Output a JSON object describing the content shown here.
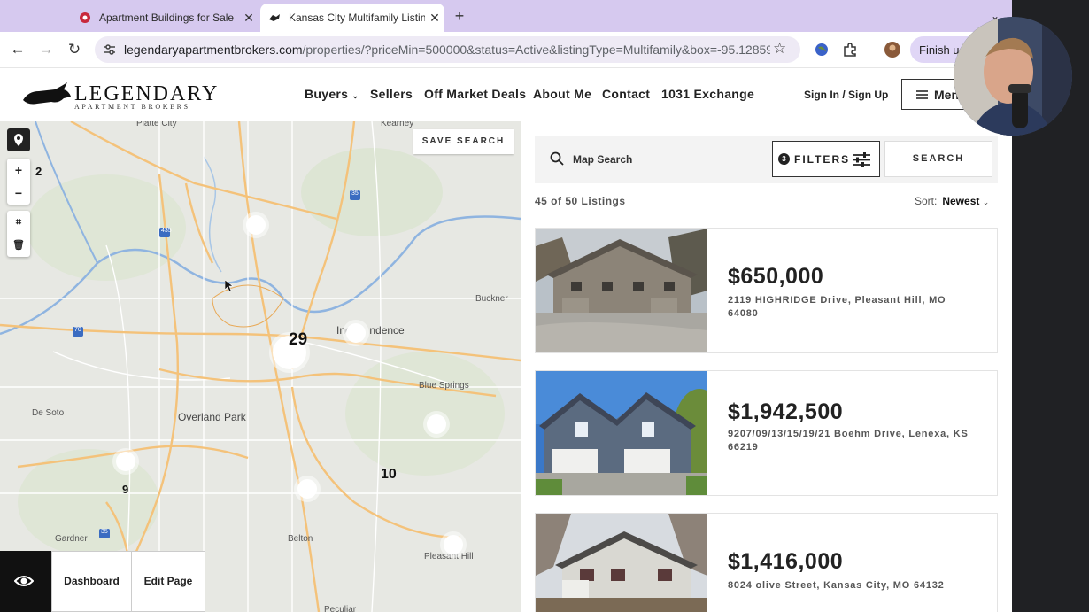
{
  "browser": {
    "tabs": [
      {
        "title": "Apartment Buildings for Sale",
        "active": false
      },
      {
        "title": "Kansas City Multifamily Listin",
        "active": true
      }
    ],
    "url_domain": "legendaryapartmentbrokers.com",
    "url_path": "/properties/?priceMin=500000&status=Active&listingType=Multifamily&box=-95.12859...",
    "finish_label": "Finish u"
  },
  "site": {
    "logo_word": "LEGENDARY",
    "logo_sub": "APARTMENT BROKERS",
    "nav": [
      "Buyers",
      "Sellers",
      "Off Market Deals",
      "About Me",
      "Contact",
      "1031 Exchange"
    ],
    "sign_in": "Sign In",
    "sign_sep": "/",
    "sign_up": "Sign Up",
    "menu_label": "Menu"
  },
  "map": {
    "save_search": "SAVE SEARCH",
    "zoom_level": "2",
    "labels": {
      "platte_city": "Platte City",
      "kearney": "Kearney",
      "buckner": "Buckner",
      "independence": "Inde",
      "independence2": "ndence",
      "blue_springs": "Blue Springs",
      "overland_park": "Overland Park",
      "de_soto": "De Soto",
      "gardner": "Gardner",
      "belton": "Belton",
      "pleasant_hill": "Pleasant Hill",
      "peculiar": "Peculiar"
    },
    "road_numbers": [
      "435",
      "35",
      "70",
      "35"
    ],
    "cluster_counts": [
      "29",
      "10",
      "9"
    ]
  },
  "admin": {
    "dashboard": "Dashboard",
    "edit_page": "Edit Page"
  },
  "listings": {
    "search_placeholder": "Map Search",
    "filters_count": "3",
    "filters_label": "FILTERS",
    "search_button": "SEARCH",
    "count_text": "45 of 50 Listings",
    "sort_label": "Sort:",
    "sort_value": "Newest",
    "items": [
      {
        "price": "$650,000",
        "address": "2119 HIGHRIDGE Drive, Pleasant Hill, MO 64080"
      },
      {
        "price": "$1,942,500",
        "address": "9207/09/13/15/19/21 Boehm Drive, Lenexa, KS 66219"
      },
      {
        "price": "$1,416,000",
        "address": "8024 olive Street, Kansas City, MO 64132"
      }
    ]
  },
  "colors": {
    "tabstrip": "#d6c9ef",
    "omnibox": "#eeeaf5",
    "map_bg": "#e7e8e3",
    "road": "#f4c27a",
    "river": "#8fb4e0"
  }
}
